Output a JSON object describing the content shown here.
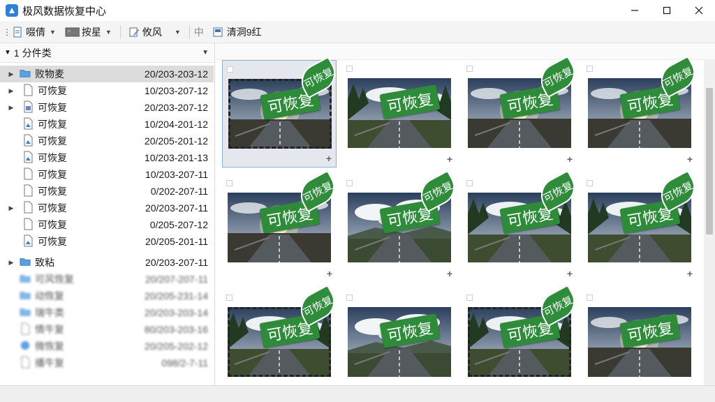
{
  "window": {
    "title": "极风数据恢复中心"
  },
  "toolbar": {
    "items": [
      {
        "label": "啜倩",
        "icon": "document-icon"
      },
      {
        "label": "按星",
        "icon": "gallery-icon"
      },
      {
        "label": "攸风",
        "icon": "edit-icon"
      }
    ],
    "separator_label": "中",
    "preview_label": "清洞9红"
  },
  "left_panel": {
    "header": "1 分件类",
    "rows": [
      {
        "name": "败物麦",
        "date": "20/203-203-12",
        "icon": "folder-icon"
      },
      {
        "name": "可恢复",
        "date": "10/203-207-12",
        "icon": "file-icon"
      },
      {
        "name": "可恢复",
        "date": "20/203-207-12",
        "icon": "spreadsheet-icon"
      },
      {
        "name": "可恢复",
        "date": "10/204-201-12",
        "icon": "image-file-icon"
      },
      {
        "name": "可恢复",
        "date": "20/205-201-12",
        "icon": "image-file-icon"
      },
      {
        "name": "可恢复",
        "date": "10/203-201-13",
        "icon": "image-file-icon"
      },
      {
        "name": "可恢复",
        "date": "10/203-207-11",
        "icon": "file-icon"
      },
      {
        "name": "可恢复",
        "date": "0/202-207-11",
        "icon": "file-icon"
      },
      {
        "name": "可恢复",
        "date": "20/203-207-11",
        "icon": "file-icon"
      },
      {
        "name": "可恢复",
        "date": "0/205-207-12",
        "icon": "file-icon"
      },
      {
        "name": "可恢复",
        "date": "20/205-201-11",
        "icon": "image-file-icon"
      },
      {
        "name": "致粘",
        "date": "20/203-207-11",
        "icon": "folder-icon"
      },
      {
        "name": "可风恢复",
        "date": "20/207-207-11",
        "icon": "folder-icon"
      },
      {
        "name": "动恢复",
        "date": "20/205-231-14",
        "icon": "folder-icon"
      },
      {
        "name": "瑞牛类",
        "date": "20/203-203-14",
        "icon": "folder-icon"
      },
      {
        "name": "情牛复",
        "date": "80/203-203-16",
        "icon": "file-icon"
      },
      {
        "name": "微恢复",
        "date": "20/205-202-12",
        "icon": "globe-icon"
      },
      {
        "name": "播牛复",
        "date": "098/2-7-11",
        "icon": "file-icon"
      }
    ]
  },
  "grid": {
    "stamp_text": "可恢复",
    "leaf_text": "可恢复",
    "plus_label": "+",
    "items": [
      {
        "scene": "sun-road",
        "dashed": true,
        "leaf": true,
        "selected": true
      },
      {
        "scene": "forest-road",
        "dashed": false,
        "leaf": false,
        "selected": false
      },
      {
        "scene": "sun-road",
        "dashed": false,
        "leaf": true,
        "selected": false
      },
      {
        "scene": "sun-road",
        "dashed": false,
        "leaf": true,
        "selected": false
      },
      {
        "scene": "sun-road",
        "dashed": false,
        "leaf": true,
        "selected": false
      },
      {
        "scene": "clouds-road",
        "dashed": false,
        "leaf": true,
        "selected": false
      },
      {
        "scene": "forest-road",
        "dashed": false,
        "leaf": true,
        "selected": false
      },
      {
        "scene": "forest-road",
        "dashed": false,
        "leaf": true,
        "selected": false
      },
      {
        "scene": "forest-road",
        "dashed": true,
        "leaf": true,
        "selected": false
      },
      {
        "scene": "clouds-road",
        "dashed": false,
        "leaf": false,
        "selected": false
      },
      {
        "scene": "forest-road",
        "dashed": true,
        "leaf": true,
        "selected": false
      },
      {
        "scene": "sun-road",
        "dashed": false,
        "leaf": false,
        "selected": false
      }
    ]
  }
}
